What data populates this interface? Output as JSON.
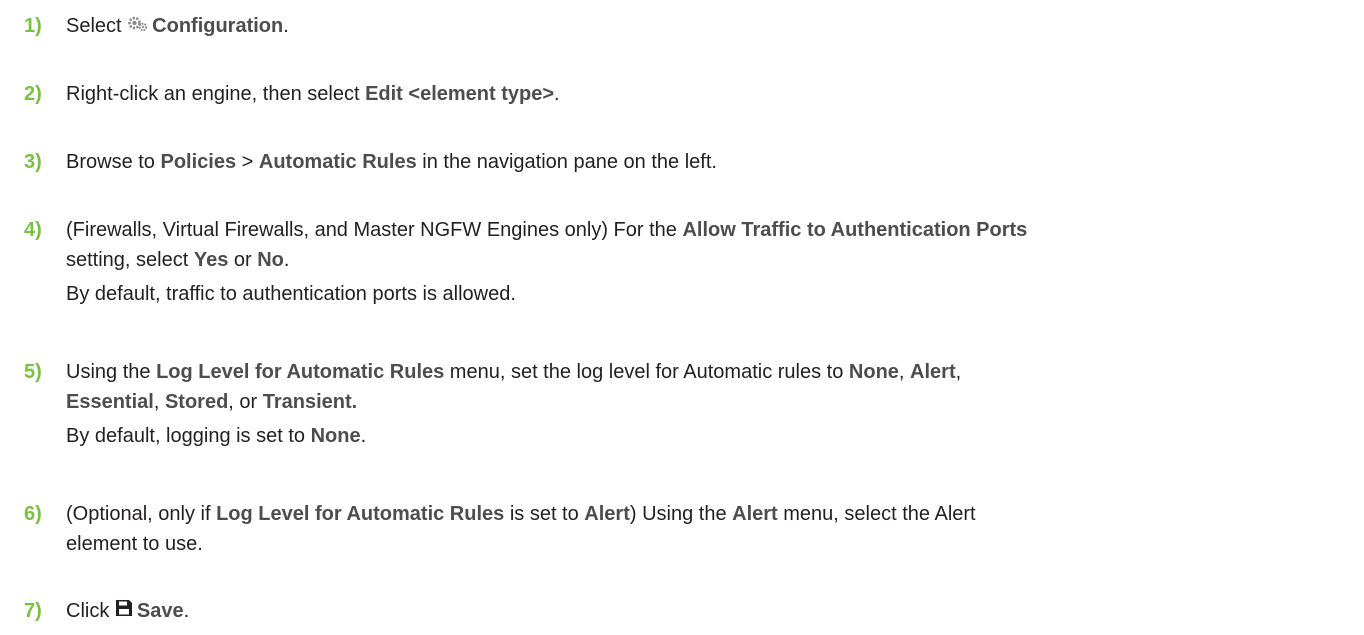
{
  "steps": [
    {
      "num": "1)",
      "lines": [
        [
          {
            "t": "Select "
          },
          {
            "icon": "gear-icon"
          },
          {
            "t": "Configuration",
            "b": true
          },
          {
            "t": "."
          }
        ]
      ]
    },
    {
      "num": "2)",
      "lines": [
        [
          {
            "t": "Right-click an engine, then select "
          },
          {
            "t": "Edit <element type>",
            "b": true
          },
          {
            "t": "."
          }
        ]
      ]
    },
    {
      "num": "3)",
      "lines": [
        [
          {
            "t": "Browse to "
          },
          {
            "t": "Policies",
            "b": true
          },
          {
            "t": " > "
          },
          {
            "t": "Automatic Rules",
            "b": true
          },
          {
            "t": " in the navigation pane on the left."
          }
        ]
      ]
    },
    {
      "num": "4)",
      "lines": [
        [
          {
            "t": "(Firewalls, Virtual Firewalls, and Master NGFW Engines only) For the "
          },
          {
            "t": "Allow Traffic to Authentication Ports",
            "b": true
          }
        ],
        [
          {
            "t": "setting, select "
          },
          {
            "t": "Yes",
            "b": true
          },
          {
            "t": " or "
          },
          {
            "t": "No",
            "b": true
          },
          {
            "t": "."
          }
        ],
        [
          {
            "t": "By default, traffic to authentication ports is allowed."
          }
        ]
      ]
    },
    {
      "num": "5)",
      "lines": [
        [
          {
            "t": "Using the "
          },
          {
            "t": "Log Level for Automatic Rules",
            "b": true
          },
          {
            "t": " menu, set the log level for Automatic rules to "
          },
          {
            "t": "None",
            "b": true
          },
          {
            "t": ", "
          },
          {
            "t": "Alert",
            "b": true
          },
          {
            "t": ","
          }
        ],
        [
          {
            "t": "Essential",
            "b": true
          },
          {
            "t": ", "
          },
          {
            "t": "Stored",
            "b": true
          },
          {
            "t": ", or "
          },
          {
            "t": "Transient.",
            "b": true
          }
        ],
        [
          {
            "t": "By default, logging is set to "
          },
          {
            "t": "None",
            "b": true
          },
          {
            "t": "."
          }
        ]
      ]
    },
    {
      "num": "6)",
      "lines": [
        [
          {
            "t": "(Optional, only if "
          },
          {
            "t": "Log Level for Automatic Rules",
            "b": true
          },
          {
            "t": " is set to "
          },
          {
            "t": "Alert",
            "b": true
          },
          {
            "t": ") Using the "
          },
          {
            "t": "Alert",
            "b": true
          },
          {
            "t": " menu, select the Alert"
          }
        ],
        [
          {
            "t": "element to use."
          }
        ]
      ]
    },
    {
      "num": "7)",
      "lines": [
        [
          {
            "t": "Click "
          },
          {
            "icon": "save-icon"
          },
          {
            "t": "Save",
            "b": true
          },
          {
            "t": "."
          }
        ]
      ]
    }
  ]
}
